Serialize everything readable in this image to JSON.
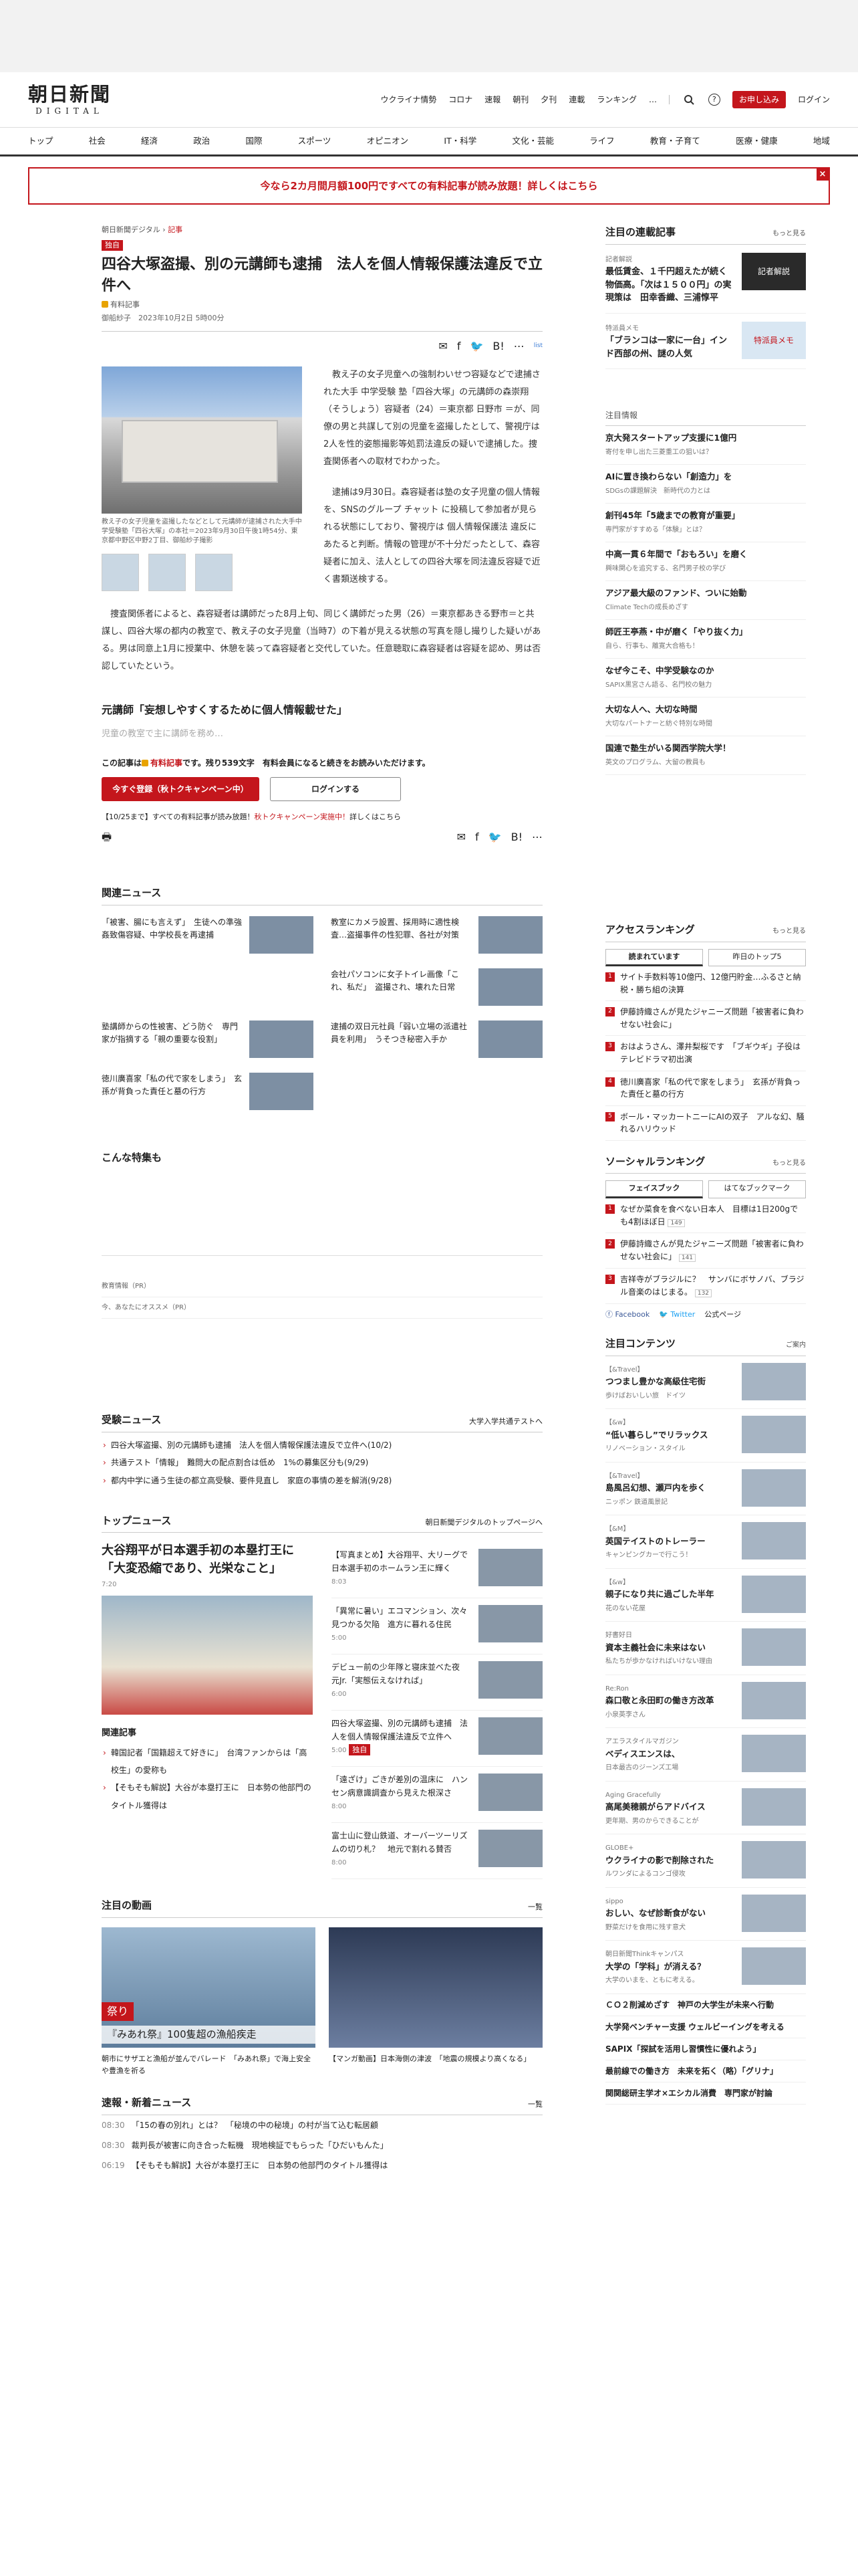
{
  "logo": {
    "main": "朝日新聞",
    "sub": "DIGITAL"
  },
  "header_nav": [
    "ウクライナ情勢",
    "コロナ",
    "速報",
    "朝刊",
    "夕刊",
    "連載",
    "ランキング"
  ],
  "header_actions": {
    "subscribe": "お申し込み",
    "login": "ログイン",
    "more": "…",
    "help": "?"
  },
  "categories": [
    "トップ",
    "社会",
    "経済",
    "政治",
    "国際",
    "スポーツ",
    "オピニオン",
    "IT・科学",
    "文化・芸能",
    "ライフ",
    "教育・子育て",
    "医療・健康",
    "地域"
  ],
  "promo": "今なら2カ月間月額100円ですべての有料記事が読み放題！詳しくはこちら",
  "article": {
    "crumb_site": "朝日新聞デジタル",
    "crumb_sec": "記事",
    "badge": "独自",
    "title": "四谷大塚盗撮、別の元講師も逮捕　法人を個人情報保護法違反で立件へ",
    "paid": "有料記事",
    "author": "御船紗子",
    "date": "2023年10月2日 5時00分",
    "share_more": "list",
    "caption": "教え子の女子児童を盗撮したなどとして元講師が逮捕された大手中学受験塾「四谷大塚」の本社＝2023年9月30日午後1時54分、東京都中野区中野2丁目、御船紗子撮影",
    "p1": "教え子の女子児童への強制わいせつ容疑などで逮捕された大手 中学受験 塾「四谷大塚」の元講師の森崇翔（そうしょう）容疑者（24）＝東京都 日野市 ＝が、同僚の男と共謀して別の児童を盗撮したとして、警視庁は2人を性的姿態撮影等処罰法違反の疑いで逮捕した。捜査関係者への取材でわかった。",
    "p2": "逮捕は9月30日。森容疑者は塾の女子児童の個人情報を、SNSのグループ チャット に投稿して参加者が見られる状態にしており、警視庁は 個人情報保護法 違反にあたると判断。情報の管理が不十分だったとして、森容疑者に加え、法人としての四谷大塚を同法違反容疑で近く書類送検する。",
    "p3": "捜査関係者によると、森容疑者は講師だった8月上旬、同じく講師だった男（26）＝東京都あきる野市＝と共謀し、四谷大塚の都内の教室で、教え子の女子児童（当時7）の下着が見える状態の写真を隠し撮りした疑いがある。男は同意上1月に授業中、休憩を装って森容疑者と交代していた。任意聴取に森容疑者は容疑を認め、男は否認していたという。",
    "h2": "元講師「妄想しやすくするために個人情報載せた」",
    "fade": "児童の教室で主に講師を務め…"
  },
  "paywall": {
    "text_pre": "この記事は",
    "text_paid": "有料記事",
    "text_post": "です。残り539文字　有料会員になると続きをお読みいただけます。",
    "register": "今すぐ登録（秋トクキャンペーン中）",
    "login": "ログインする",
    "note_pre": "【10/25まで】すべての有料記事が読み放題！",
    "note_red": "秋トクキャンペーン実施中！",
    "note_post": "詳しくはこちら"
  },
  "related": {
    "title": "関連ニュース",
    "items": [
      "「被害、腸にも言えず」　生徒への準強姦致傷容疑、中学校長を再逮捕",
      "教室にカメラ設置、採用時に適性検査…盗撮事件の性犯罪、各社が対策",
      "",
      "会社パソコンに女子トイレ画像「これ、私だ」　盗撮され、壊れた日常",
      "塾講師からの性被害、どう防ぐ　専門家が指摘する「親の重要な役割」",
      "逮捕の双日元社員「弱い立場の派遣社員を利用」　うそつき秘密入手か",
      "徳川廣喜家「私の代で家をしまう」　玄孫が背負った責任と墓の行方"
    ]
  },
  "tokushu": "こんな特集も",
  "pr1": "教育情報（PR）",
  "pr2": "今、あなたにオススメ（PR）",
  "juken": {
    "title": "受験ニュース",
    "link": "大学入学共通テストへ",
    "items": [
      "四谷大塚盗撮、別の元講師も逮捕　法人を個人情報保護法違反で立件へ(10/2)",
      "共通テスト「情報」　難問大の配点割合は低め　1%の募集区分も(9/29)",
      "都内中学に通う生徒の都立高受験、要件見直し　家庭の事情の差を解消(9/28)"
    ]
  },
  "top": {
    "title": "トップニュース",
    "link": "朝日新聞デジタルのトップページへ",
    "lead": "大谷翔平が日本選手初の本塁打王に「大変恐縮であり、光栄なこと」",
    "lead_time": "7:20",
    "kanren": "関連記事",
    "kanren_items": [
      "韓国記者「国籍超えて好きに」　台湾ファンからは「高校生」の愛称も",
      "【そもそも解説】大谷が本塁打王に　日本勢の他部門のタイトル獲得は"
    ],
    "right": [
      {
        "t": "【写真まとめ】大谷翔平、大リーグで日本選手初のホームラン王に輝く",
        "tm": "8:03"
      },
      {
        "t": "「異常に暑い」エコマンション、次々見つかる欠陥　進方に暮れる住民",
        "tm": "5:00"
      },
      {
        "t": "デビュー前の少年隊と寝床並べた夜　元Jr.「実態伝えなければ」",
        "tm": "6:00"
      },
      {
        "t": "四谷大塚盗撮、別の元講師も逮捕　法人を個人情報保護法違反で立件へ",
        "tm": "5:00"
      },
      {
        "t": "「遠ざけ」ごきが差別の温床に　ハンセン病意識調査から見えた根深さ",
        "tm": "8:00"
      },
      {
        "t": "富士山に登山鉄道、オーバーツーリズムの切り札？　地元で割れる賛否",
        "tm": "8:00"
      }
    ],
    "exclusive": "独自"
  },
  "douga": {
    "title": "注目の動画",
    "link": "一覧",
    "cap1": "朝市にサザエと漁船が並んでバレード　「みあれ祭」で海上安全や豊漁を祈る",
    "cap2": "【マンガ動画】日本海側の津波　「地震の規模より高くなる」",
    "overlay": "『みあれ祭』100隻超の漁船疾走",
    "tag": "祭り"
  },
  "sokuho": {
    "title": "速報・新着ニュース",
    "link": "一覧",
    "items": [
      {
        "tm": "08:30",
        "t": "「15の春の別れ」とは？　「秘境の中の秘境」の村が当て込む転居顧"
      },
      {
        "tm": "08:30",
        "t": "裁判長が被害に向き合った転機　現地検証でもらった「ひだいもんた」"
      },
      {
        "tm": "06:19",
        "t": "【そもそも解説】大谷が本塁打王に　日本勢の他部門のタイトル獲得は"
      }
    ]
  },
  "side_rensai": {
    "title": "注目の連載記事",
    "more": "もっと見る",
    "items": [
      {
        "lbl": "記者解説",
        "t": "最低賃金、１千円超えたが続く物価高。「次は１５００円」の実現策は　田幸香織、三浦惇平",
        "box": "記者解説"
      },
      {
        "lbl": "特派員メモ",
        "t": "「ブランコは一家に一台」インド西部の州、謎の人気",
        "box": "特派員メモ"
      }
    ]
  },
  "side_chui": {
    "title": "注目情報",
    "items": [
      {
        "t": "京大発スタートアップ支援に1億円",
        "s": "寄付を申し出た三菱重工の狙いは？"
      },
      {
        "t": "AIに置き換わらない「創造力」を",
        "s": "SDGsの課題解決　新時代の力とは"
      },
      {
        "t": "創刊45年「5歳までの教育が重要」",
        "s": "専門家がすすめる「体験」とは？"
      },
      {
        "t": "中高一貫６年間で「おもろい」を磨く",
        "s": "興味関心を追究する、名門男子校の学び"
      },
      {
        "t": "アジア最大級のファンド、ついに始動",
        "s": "Climate Techの成長めざす"
      },
      {
        "t": "師匠王亭燕・中が磨く「やり抜く力」",
        "s": "自ら、行事も、離寛大合格も！"
      },
      {
        "t": "なぜ今こそ、中学受験なのか",
        "s": "SAPIX黒宮さん語る、名門校の魅力"
      },
      {
        "t": "大切な人へ、大切な時間",
        "s": "大切なパートナーと紡ぐ特別な時間"
      },
      {
        "t": "国連で塾生がいる関西学院大学！",
        "s": "英文のプログラム、大留の教員も"
      }
    ]
  },
  "access": {
    "title": "アクセスランキング",
    "more": "もっと見る",
    "tab1": "読まれています",
    "tab2": "昨日のトップ5",
    "items": [
      "サイト手数料等10億円、12億円貯金…ふるさと納税・勝ち組の決算",
      "伊藤詩織さんが見たジャニーズ問題「被害者に負わせない社会に」",
      "おはようさん、澤井梨桜です　「ブギウギ」子役はテレビドラマ初出演",
      "徳川廣喜家「私の代で家をしまう」　玄孫が背負った責任と墓の行方",
      "ボール・マッカートニーにAIの双子　アルな幻、騒れるハリウッド"
    ]
  },
  "social": {
    "title": "ソーシャルランキング",
    "more": "もっと見る",
    "tab1": "フェイスブック",
    "tab2": "はてなブックマーク",
    "items": [
      {
        "t": "なぜか菜食を食べない日本人　目標は1日200gでも4割ほぼ日",
        "c": "149"
      },
      {
        "t": "伊藤詩織さんが見たジャニーズ問題「被害者に負わせない社会に」",
        "c": "141"
      },
      {
        "t": "吉祥寺がブラジルに？　サンバにボサノバ、ブラジル音楽のはじまる。",
        "c": "132"
      }
    ],
    "fb": "Facebook",
    "tw": "Twitter",
    "page": "公式ページ"
  },
  "contents": {
    "title": "注目コンテンツ",
    "more": "ご案内",
    "items": [
      {
        "l": "【&Travel】",
        "t": "つつまし豊かな高級住宅街",
        "s": "歩けばおいしい旅　ドイツ"
      },
      {
        "l": "【&w】",
        "t": "“低い暮らし”でリラックス",
        "s": "リノベーション・スタイル"
      },
      {
        "l": "【&Travel】",
        "t": "島風呂幻想、瀬戸内を歩く",
        "s": "ニッポン 鉄道風景記"
      },
      {
        "l": "【&M】",
        "t": "英国テイストのトレーラー",
        "s": "キャンピングカーで行こう！"
      },
      {
        "l": "【&w】",
        "t": "親子になり共に過ごした半年",
        "s": "花のない花屋"
      },
      {
        "l": "好書好日",
        "t": "資本主義社会に未来はない",
        "s": "私たちが歩かなければいけない理由"
      },
      {
        "l": "Re:Ron",
        "t": "森口敬と永田町の働き方改革",
        "s": "小泉英李さん"
      },
      {
        "l": "アエラスタイルマガジン",
        "t": "ベディスエンスは、",
        "s": "日本最古のジーンズ工場"
      },
      {
        "l": "Aging Gracefully",
        "t": "高尾美穂親がらアドバイス",
        "s": "更年期、男のからできることが"
      },
      {
        "l": "GLOBE+",
        "t": "ウクライナの影で削除された",
        "s": "ルワンダによるコンゴ侵攻"
      },
      {
        "l": "sippo",
        "t": "おしい、なぜ診断食がない",
        "s": "野菜だけを食用に残す意犬"
      },
      {
        "l": "朝日新聞Thinkキャンパス",
        "t": "大学の「学科」が消える？",
        "s": "大学のいまを、ともに考える。"
      }
    ],
    "list": [
      "ＣＯ２削減めざす　神戸の大学生が未来へ行動",
      "大学発ベンチャー支援 ウェルビーイングを考える",
      "SAPIX「探試を活用し習慣性に優れよう」",
      "最前線での働き方　未来を拓く（略）「グリナ」",
      "関関総研主学オ×エシカル消費　専門家が討論"
    ]
  }
}
